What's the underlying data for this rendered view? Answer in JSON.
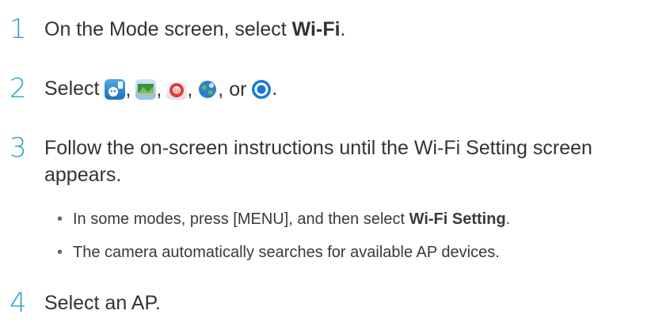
{
  "steps": [
    {
      "number": "1",
      "prefix": "On the Mode screen, select ",
      "bold": "Wi-Fi",
      "suffix": "."
    },
    {
      "number": "2",
      "prefix": "Select ",
      "separator": ",",
      "or": ", or ",
      "end": "."
    },
    {
      "number": "3",
      "line1": "Follow the on-screen instructions until the Wi-Fi Setting screen",
      "line2": "appears."
    },
    {
      "number": "4",
      "text": "Select an AP."
    }
  ],
  "bullets": [
    {
      "prefix": "In some modes, press [MENU], and then select ",
      "bold": "Wi-Fi Setting",
      "suffix": "."
    },
    {
      "text": "The camera automatically searches for available AP devices."
    }
  ],
  "icons": [
    "mobile-link-icon",
    "pc-auto-backup-icon",
    "email-icon",
    "sns-cloud-icon",
    "tv-link-icon"
  ]
}
